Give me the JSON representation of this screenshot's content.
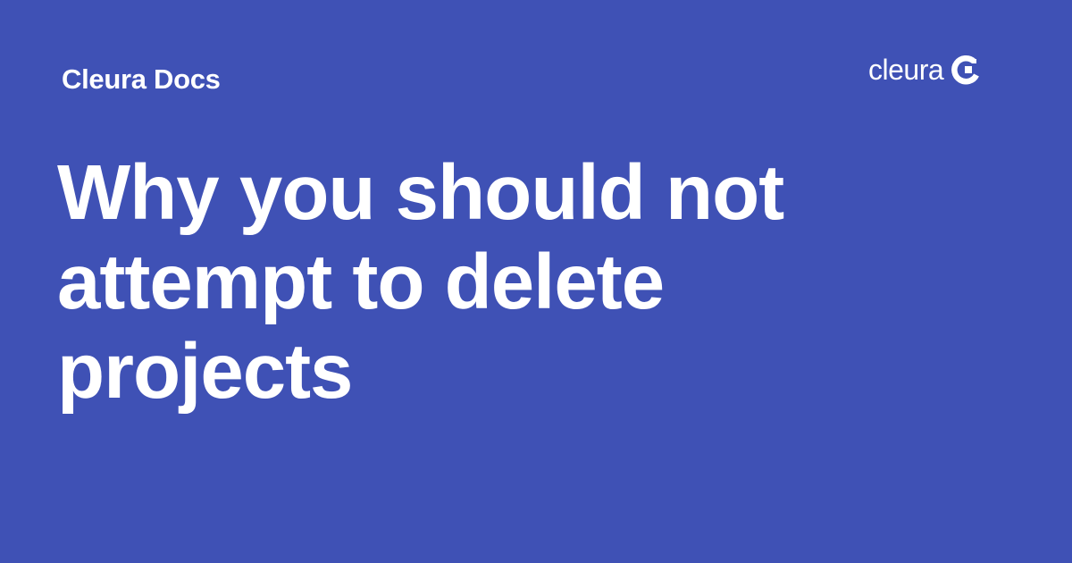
{
  "header": {
    "site_name": "Cleura Docs"
  },
  "logo": {
    "wordmark": "cleura",
    "icon": "cleura-c-icon"
  },
  "main": {
    "title": "Why you should not attempt to delete projects"
  },
  "colors": {
    "background": "#3f51b5",
    "text": "#ffffff"
  }
}
